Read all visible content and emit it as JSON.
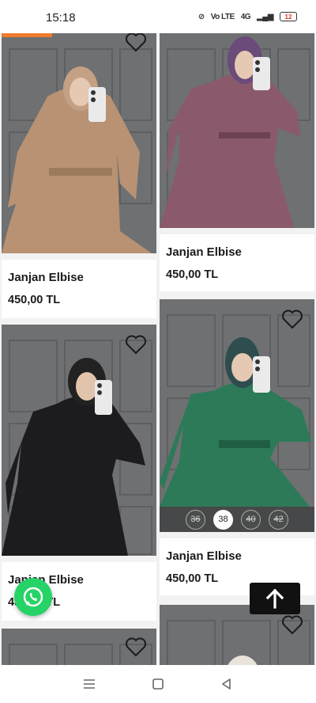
{
  "status_bar": {
    "time": "15:18",
    "signal_labels": "Vo LTE",
    "network": "4G",
    "battery": "12"
  },
  "products": [
    {
      "name": "Janjan Elbise",
      "price": "450,00 TL",
      "color": "beige"
    },
    {
      "name": "Janjan Elbise",
      "price": "450,00 TL",
      "color": "mauve"
    },
    {
      "name": "Janjan Elbise",
      "price": "450,00 TL",
      "color": "black"
    },
    {
      "name": "Janjan Elbise",
      "price": "450,00 TL",
      "color": "emerald",
      "sizes": [
        {
          "label": "36",
          "available": false
        },
        {
          "label": "38",
          "available": true
        },
        {
          "label": "40",
          "available": false
        },
        {
          "label": "42",
          "available": false
        }
      ]
    }
  ],
  "partial_card_overlap_text": {
    "price_prefix": "45",
    "price_suffix": "TL"
  },
  "colors": {
    "accent_orange": "#f07b2d",
    "whatsapp_green": "#25d366",
    "background": "#f2f2f2"
  },
  "icons": {
    "favorite": "heart-outline-icon",
    "whatsapp": "whatsapp-icon",
    "scroll_top": "arrow-up-icon",
    "nav_menu": "menu-icon",
    "nav_home": "square-home-icon",
    "nav_back": "triangle-back-icon"
  }
}
